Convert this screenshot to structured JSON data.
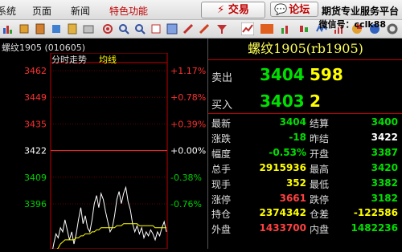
{
  "menu": {
    "items": [
      "系统",
      "页面",
      "新闻",
      "特色功能"
    ],
    "trade_label": "⚡ 交易",
    "forum_label": "论坛",
    "promo_line1": "期货专业服务平台",
    "promo_line2": "微信号：cclk88"
  },
  "chart": {
    "instrument": "螺纹1905 (010605)",
    "tab_minute": "分时走势",
    "tab_avg": "均线",
    "price_ticks": [
      "3462",
      "3449",
      "3435",
      "3422",
      "3409",
      "3396"
    ],
    "pct_ticks": [
      "+1.17%",
      "+0.78%",
      "+0.39%",
      "+0.00%",
      "-0.38%",
      "-0.76%"
    ],
    "colors": {
      "up": "#ff3030",
      "down": "#00d000",
      "flat": "#ffffff",
      "avg": "#ffff00",
      "price": "#ffffff"
    }
  },
  "chart_data": {
    "type": "line",
    "title": "",
    "ylim": [
      3396,
      3462
    ],
    "reference": 3422,
    "series": [
      {
        "name": "分时走势",
        "values": [
          3392,
          3398,
          3403,
          3401,
          3406,
          3404,
          3410,
          3405,
          3400,
          3404,
          3398,
          3403,
          3410,
          3416,
          3408,
          3412,
          3406,
          3404,
          3410,
          3418,
          3422,
          3416,
          3423,
          3420,
          3414,
          3409,
          3404,
          3406,
          3412,
          3420,
          3424,
          3418,
          3423,
          3426,
          3419,
          3415,
          3408,
          3404,
          3407,
          3403,
          3406,
          3401,
          3404,
          3402,
          3405,
          3403,
          3400,
          3404,
          3402,
          3406,
          3409,
          3404
        ]
      },
      {
        "name": "均线",
        "values": [
          3392,
          3393,
          3395,
          3396,
          3398,
          3399,
          3400,
          3400,
          3400,
          3400,
          3400,
          3401,
          3401,
          3402,
          3402,
          3403,
          3403,
          3403,
          3404,
          3404,
          3405,
          3405,
          3406,
          3406,
          3406,
          3406,
          3406,
          3406,
          3406,
          3407,
          3407,
          3407,
          3408,
          3408,
          3408,
          3408,
          3408,
          3408,
          3408,
          3407,
          3407,
          3407,
          3407,
          3407,
          3407,
          3407,
          3406,
          3406,
          3406,
          3406,
          3406,
          3406
        ]
      }
    ]
  },
  "panel": {
    "title": "螺纹1905(rb1905)",
    "ask_label": "卖出",
    "ask_price": "3404",
    "ask_volume": "598",
    "bid_label": "买入",
    "bid_price": "3403",
    "bid_volume": "2",
    "rows": [
      {
        "l1": "最新",
        "v1": "3404",
        "c1": "green",
        "l2": "结算",
        "v2": "3400",
        "c2": "green"
      },
      {
        "l1": "涨跌",
        "v1": "-18",
        "c1": "green",
        "l2": "昨结",
        "v2": "3422",
        "c2": "white"
      },
      {
        "l1": "幅度",
        "v1": "-0.53%",
        "c1": "green",
        "l2": "开盘",
        "v2": "3387",
        "c2": "green"
      },
      {
        "l1": "总手",
        "v1": "2915936",
        "c1": "yellow",
        "l2": "最高",
        "v2": "3420",
        "c2": "green"
      },
      {
        "l1": "现手",
        "v1": "352",
        "c1": "yellow",
        "l2": "最低",
        "v2": "3382",
        "c2": "green"
      },
      {
        "l1": "涨停",
        "v1": "3661",
        "c1": "red",
        "l2": "跌停",
        "v2": "3182",
        "c2": "green"
      },
      {
        "l1": "持仓",
        "v1": "2374342",
        "c1": "yellow",
        "l2": "仓差",
        "v2": "-122586",
        "c2": "yellow"
      },
      {
        "l1": "外盘",
        "v1": "1433700",
        "c1": "red",
        "l2": "内盘",
        "v2": "1482236",
        "c2": "green"
      }
    ]
  }
}
